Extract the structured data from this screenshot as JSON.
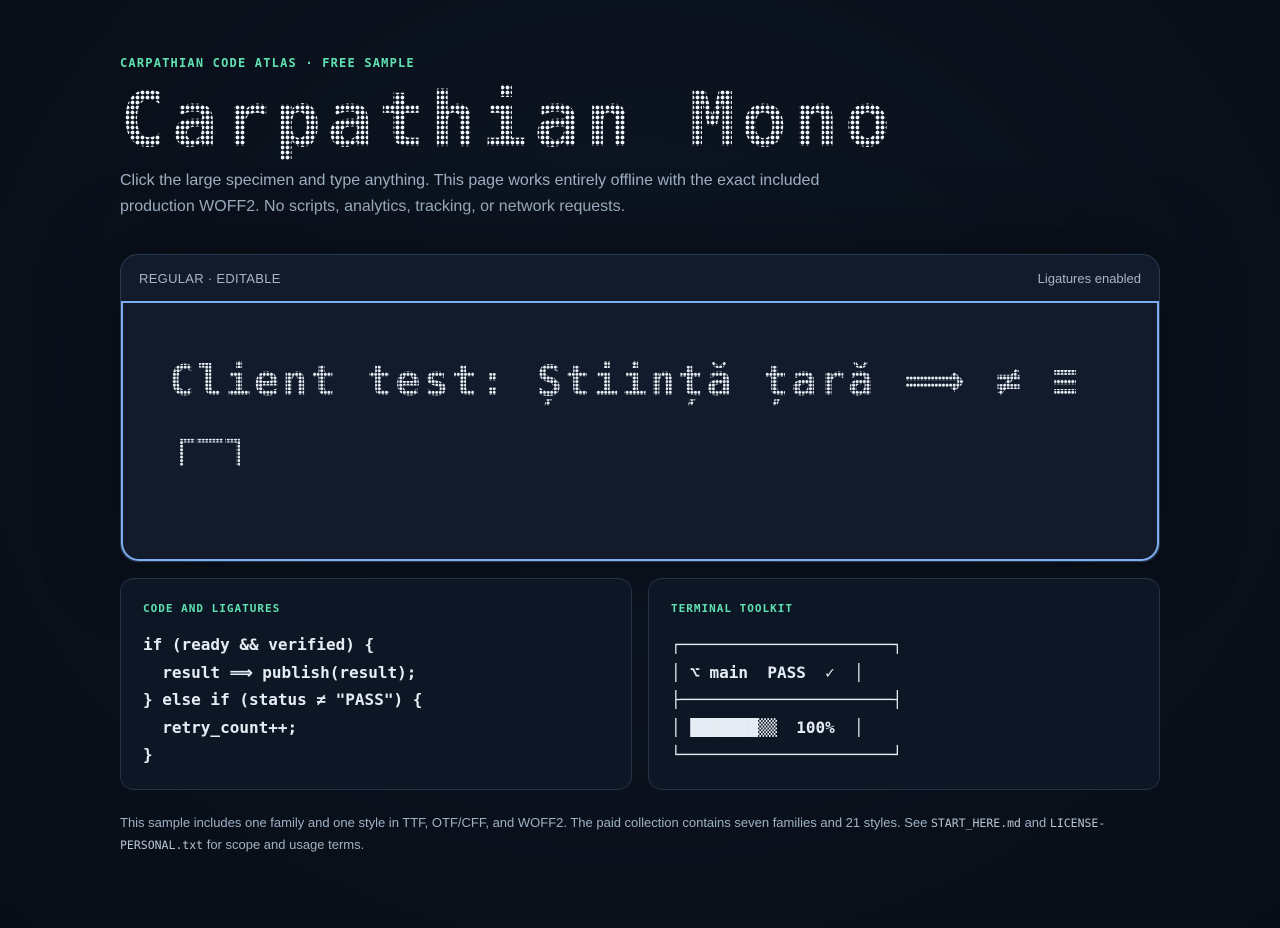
{
  "header": {
    "eyebrow": "CARPATHIAN CODE ATLAS · FREE SAMPLE",
    "title": "Carpathian Mono",
    "intro": "Click the large specimen and type anything. This page works entirely offline with the exact included production WOFF2. No scripts, analytics, tracking, or network requests."
  },
  "specimen": {
    "style_label": "REGULAR · EDITABLE",
    "ligature_status": "Ligatures enabled",
    "text": "Client test: Știință țară ⟹ ≠ ≡ ┌─┐"
  },
  "code_panel": {
    "title": "CODE AND LIGATURES",
    "code": "if (ready && verified) {\n  result ⟹ publish(result);\n} else if (status ≠ \"PASS\") {\n  retry_count++;\n}"
  },
  "terminal_panel": {
    "title": "TERMINAL TOOLKIT",
    "box": "┌──────────────────────┐\n│ ⌥ main  PASS  ✓  │\n├──────────────────────┤\n│ ███████▒▒  100%  │\n└──────────────────────┘"
  },
  "footer": {
    "text_1": "This sample includes one family and one style in TTF, OTF/CFF, and WOFF2. The paid collection contains seven families and 21 styles. See ",
    "file_1": "START_HERE.md",
    "text_2": " and ",
    "file_2": "LICENSE-PERSONAL.txt",
    "text_3": " for scope and usage terms."
  },
  "colors": {
    "accent": "#5fe0b0",
    "focus_border": "#7eaef0",
    "background": "#0a111c"
  }
}
